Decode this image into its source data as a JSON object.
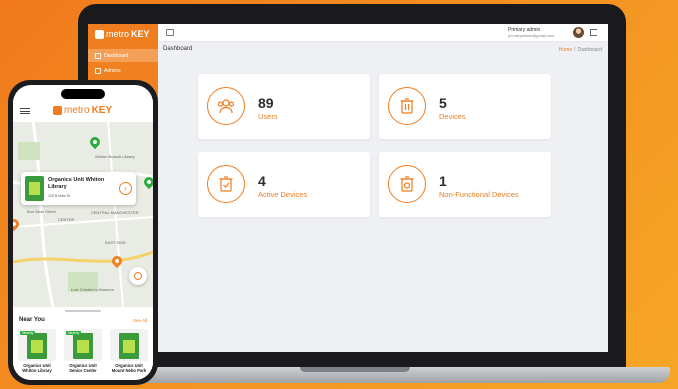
{
  "brand": {
    "name_a": "metro",
    "name_b": "KEY",
    "accent": "#ef7d1f"
  },
  "sidebar": {
    "items": [
      {
        "label": "Dashboard"
      },
      {
        "label": "Admins"
      }
    ]
  },
  "topbar": {
    "admin_name": "Primary admin",
    "admin_email": "primaryadmin@gmail.com"
  },
  "page": {
    "title": "Dashboard",
    "breadcrumb": {
      "home": "Home",
      "sep": "/",
      "current": "Dashboard"
    }
  },
  "cards": [
    {
      "value": "89",
      "label": "Users",
      "icon": "users-icon"
    },
    {
      "value": "5",
      "label": "Devices",
      "icon": "trash-icon"
    },
    {
      "value": "4",
      "label": "Active Devices",
      "icon": "active-bin-icon"
    },
    {
      "value": "1",
      "label": "Non-Functional Devices",
      "icon": "broken-bin-icon"
    }
  ],
  "phone": {
    "map_labels": [
      "Whiton Branch Library",
      "CENTER",
      "CENTRAL MANCHESTER",
      "EAST SIDE",
      "Bon Main Street",
      "Lutz Children's Museum"
    ],
    "popup": {
      "name": "Organics Unit Whiton Library",
      "address": "100 N Main St"
    },
    "near": {
      "title": "Near You",
      "see_all": "See All",
      "items": [
        {
          "badge": "Nearby",
          "name": "Organics Unit Whiton Library"
        },
        {
          "badge": "Nearby",
          "name": "Organics Unit Senior Center"
        },
        {
          "badge": "",
          "name": "Organics Unit Mount Nebo Park"
        }
      ]
    }
  }
}
